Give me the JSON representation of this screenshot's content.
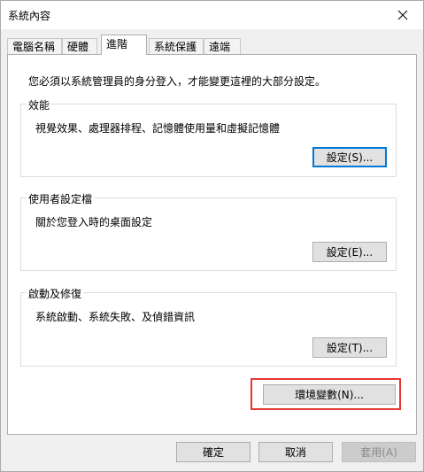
{
  "window": {
    "title": "系統內容"
  },
  "tabs": [
    {
      "label": "電腦名稱"
    },
    {
      "label": "硬體"
    },
    {
      "label": "進階"
    },
    {
      "label": "系統保護"
    },
    {
      "label": "遠端"
    }
  ],
  "advanced": {
    "intro": "您必須以系統管理員的身分登入，才能變更這裡的大部分設定。",
    "performance": {
      "title": "效能",
      "desc": "視覺效果、處理器排程、記憶體使用量和虛擬記憶體",
      "button": "設定(S)..."
    },
    "profile": {
      "title": "使用者設定檔",
      "desc": "關於您登入時的桌面設定",
      "button": "設定(E)..."
    },
    "startup": {
      "title": "啟動及修復",
      "desc": "系統啟動、系統失敗、及偵錯資訊",
      "button": "設定(T)..."
    },
    "env_button": "環境變數(N)..."
  },
  "footer": {
    "ok": "確定",
    "cancel": "取消",
    "apply": "套用(A)"
  },
  "colors": {
    "highlight": "#e53935",
    "focus": "#0078d7"
  }
}
